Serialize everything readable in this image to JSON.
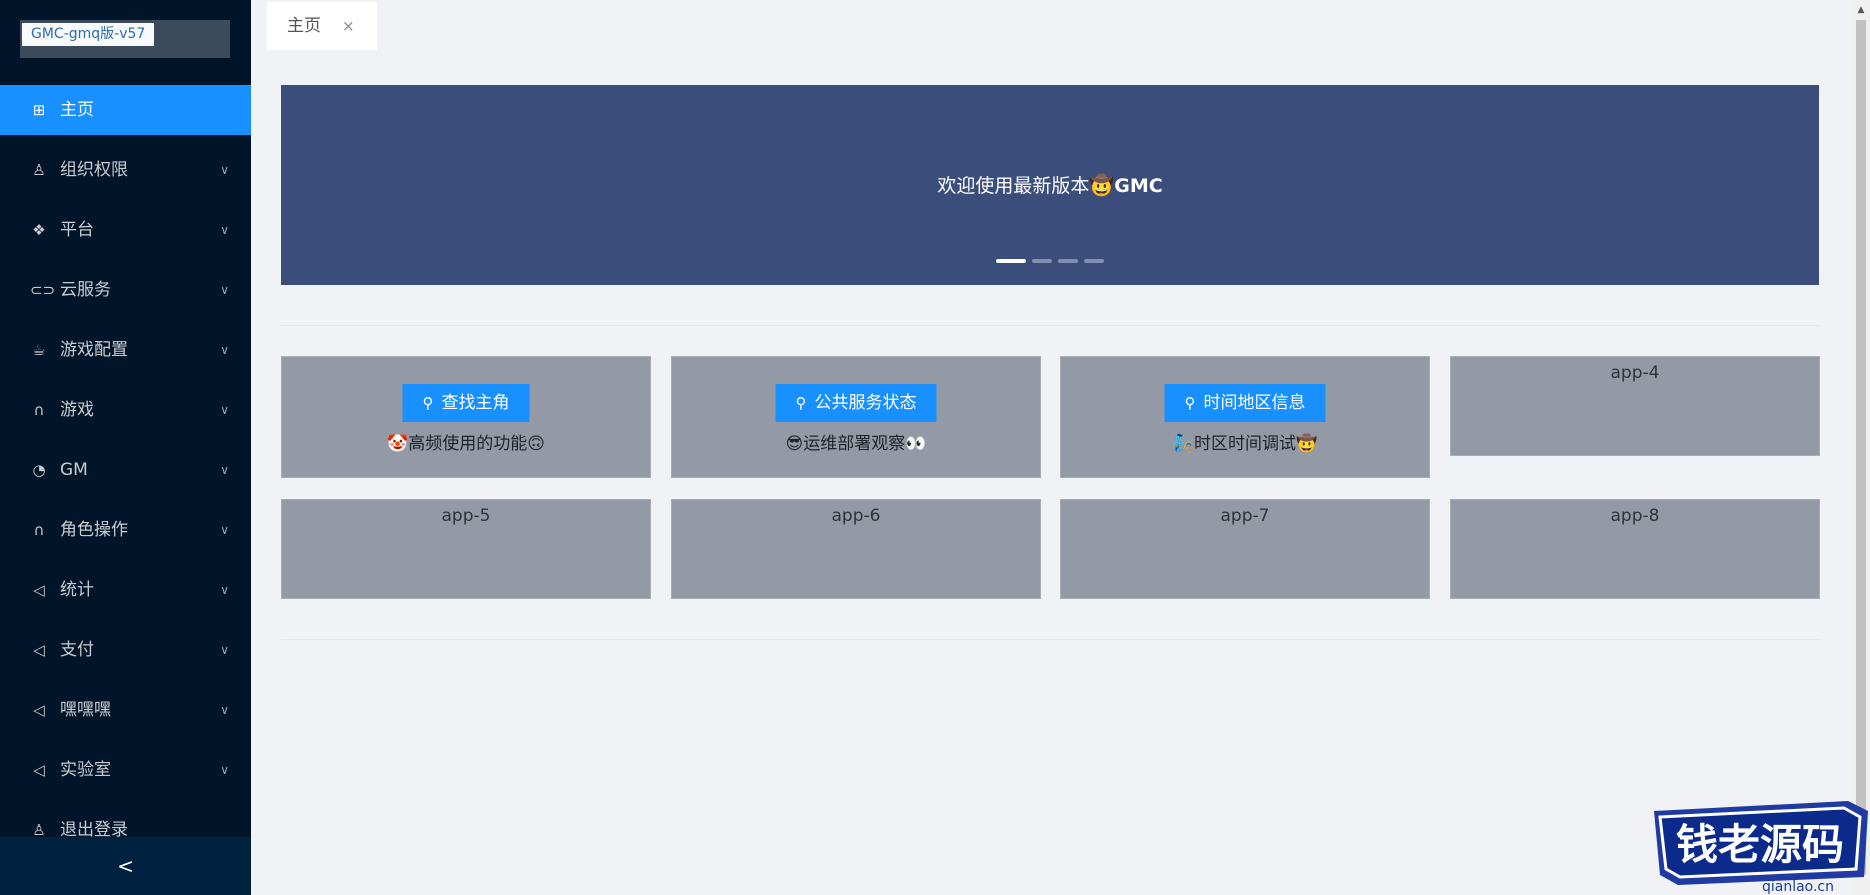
{
  "app": {
    "logo_text": "GMC-gmq版-v57"
  },
  "sidebar": {
    "items": [
      {
        "label": "主页",
        "icon": "home-icon",
        "glyph": "⊞",
        "active": true,
        "has_arrow": false
      },
      {
        "label": "组织权限",
        "icon": "user-icon",
        "glyph": "♙",
        "has_arrow": true
      },
      {
        "label": "平台",
        "icon": "dropbox-icon",
        "glyph": "❖",
        "has_arrow": true
      },
      {
        "label": "云服务",
        "icon": "link-icon",
        "glyph": "⊂⊃",
        "has_arrow": true
      },
      {
        "label": "游戏配置",
        "icon": "coffee-icon",
        "glyph": "☕",
        "has_arrow": true
      },
      {
        "label": "游戏",
        "icon": "headphones-icon",
        "glyph": "∩",
        "has_arrow": true
      },
      {
        "label": "GM",
        "icon": "dashboard-icon",
        "glyph": "◔",
        "has_arrow": true
      },
      {
        "label": "角色操作",
        "icon": "headphones-icon",
        "glyph": "∩",
        "has_arrow": true
      },
      {
        "label": "统计",
        "icon": "notification-icon",
        "glyph": "◁",
        "has_arrow": true
      },
      {
        "label": "支付",
        "icon": "notification-icon",
        "glyph": "◁",
        "has_arrow": true
      },
      {
        "label": "嘿嘿嘿",
        "icon": "notification-icon",
        "glyph": "◁",
        "has_arrow": true
      },
      {
        "label": "实验室",
        "icon": "notification-icon",
        "glyph": "◁",
        "has_arrow": true
      },
      {
        "label": "退出登录",
        "icon": "user-icon",
        "glyph": "♙",
        "has_arrow": false
      }
    ],
    "arrow_glyph": "∨",
    "collapse_glyph": "<"
  },
  "tabs": [
    {
      "label": "主页",
      "close": "×"
    }
  ],
  "banner": {
    "text": "欢迎使用最新版本",
    "emoji": "🤠",
    "brand": "GMC",
    "slides": 4,
    "active_slide": 0
  },
  "apps": [
    {
      "button": "查找主角",
      "icon": "search-icon",
      "desc": "🤡高频使用的功能🙃"
    },
    {
      "button": "公共服务状态",
      "icon": "search-icon",
      "desc": "😎运维部署观察👀"
    },
    {
      "button": "时间地区信息",
      "icon": "search-icon",
      "desc": "🧞时区时间调试🤠"
    },
    {
      "title": "app-4"
    },
    {
      "title": "app-5"
    },
    {
      "title": "app-6"
    },
    {
      "title": "app-7"
    },
    {
      "title": "app-8"
    }
  ],
  "watermark": {
    "text": "钱老源码",
    "url": "qianlao.cn"
  },
  "colors": {
    "sidebar_bg": "#001529",
    "accent": "#1890ff",
    "banner_bg": "#3a4d7b",
    "card_bg": "#949aa5"
  }
}
